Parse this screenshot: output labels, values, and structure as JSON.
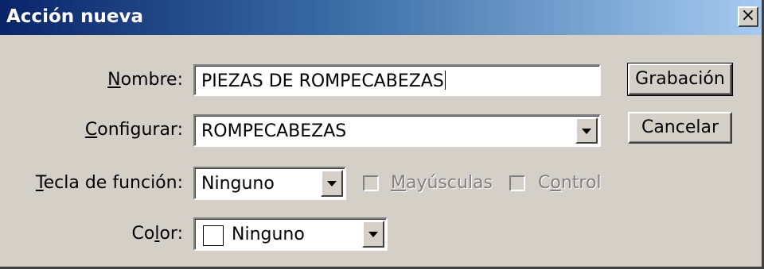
{
  "window": {
    "title": "Acción nueva",
    "close_symbol": "×"
  },
  "fields": {
    "name": {
      "label_pre": "",
      "label_key": "N",
      "label_post": "ombre:",
      "value": "PIEZAS DE ROMPECABEZAS"
    },
    "set": {
      "label_pre": "",
      "label_key": "C",
      "label_post": "onfigurar:",
      "value": "ROMPECABEZAS"
    },
    "function_key": {
      "label_pre": "",
      "label_key": "T",
      "label_post": "ecla de función:",
      "value": "Ninguno"
    },
    "color": {
      "label_pre": "Co",
      "label_key": "l",
      "label_post": "or:",
      "value": "Ninguno"
    }
  },
  "checkboxes": {
    "shift": {
      "pre": "",
      "key": "M",
      "post": "ayúsculas",
      "checked": false,
      "enabled": false
    },
    "control": {
      "pre": "C",
      "key": "o",
      "post": "ntrol",
      "checked": false,
      "enabled": false
    }
  },
  "buttons": {
    "record": "Grabación",
    "cancel": "Cancelar"
  },
  "icons": {
    "dropdown": "chevron-down-icon",
    "close": "close-icon"
  },
  "colors": {
    "title_bar_start": "#0a246a",
    "title_bar_end": "#a6caf0",
    "dialog_bg": "#d4d0c8"
  }
}
